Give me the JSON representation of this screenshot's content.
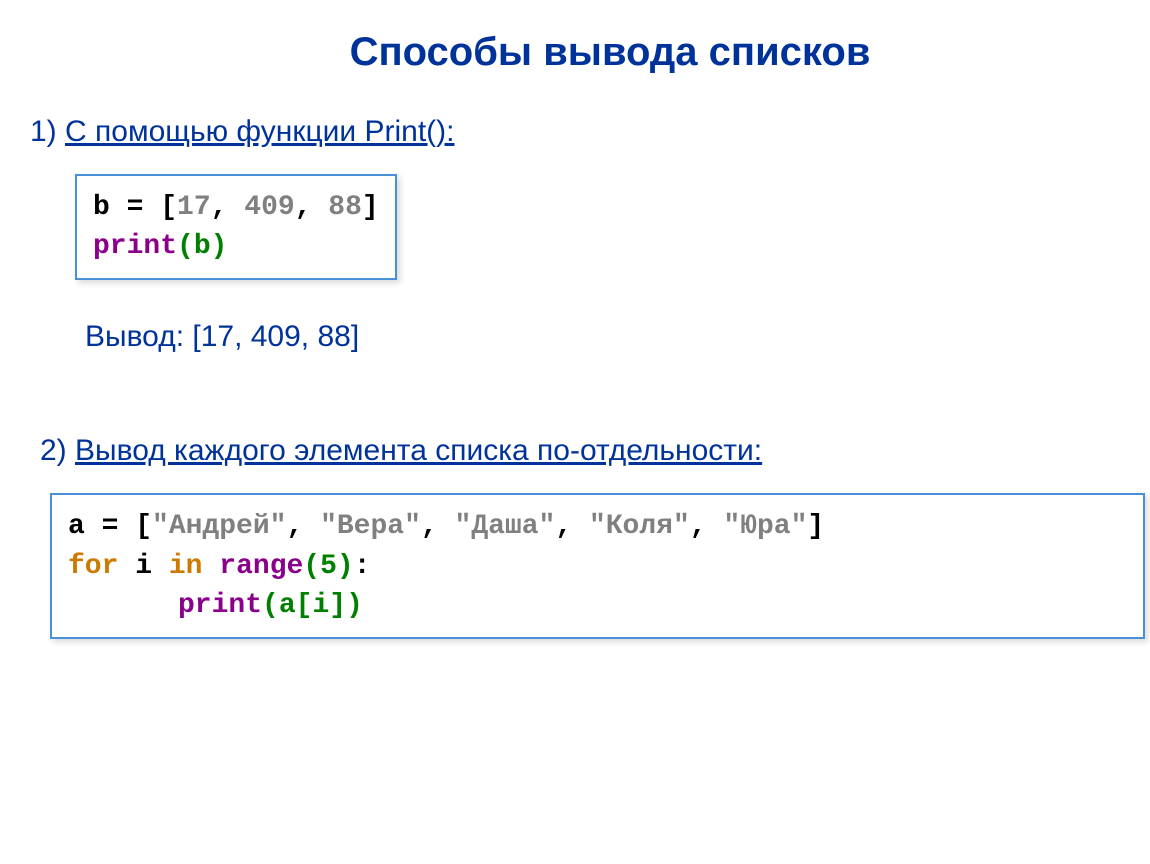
{
  "title": "Способы вывода списков",
  "section1": {
    "num": "1) ",
    "label": "С помощью функции Print():"
  },
  "code1": {
    "l1_var": "b",
    "l1_eq": " = ",
    "l1_open": "[",
    "l1_v1": "17",
    "l1_c1": ", ",
    "l1_v2": "409",
    "l1_c2": ", ",
    "l1_v3": "88",
    "l1_close": "]",
    "l2_func": "print",
    "l2_open": "(",
    "l2_arg": "b",
    "l2_close": ")"
  },
  "output": "Вывод: [17, 409, 88]",
  "section2": {
    "num": "2) ",
    "label": "Вывод каждого элемента списка по-отдельности:"
  },
  "code2": {
    "l1_var": "a",
    "l1_eq": " = ",
    "l1_open": "[",
    "l1_s1": "\"Андрей\"",
    "l1_c1": ", ",
    "l1_s2": "\"Вера\"",
    "l1_c2": ", ",
    "l1_s3": "\"Даша\"",
    "l1_c3": ", ",
    "l1_s4": "\"Коля\"",
    "l1_c4": ", ",
    "l1_s5": "\"Юра\"",
    "l1_close": "]",
    "l2_for": "for",
    "l2_sp1": " ",
    "l2_i": "i",
    "l2_sp2": " ",
    "l2_in": "in",
    "l2_sp3": " ",
    "l2_range": "range",
    "l2_open": "(",
    "l2_five": "5",
    "l2_close": ")",
    "l2_colon": ":",
    "l3_func": "print",
    "l3_open": "(",
    "l3_a": "a",
    "l3_bopen": "[",
    "l3_i": "i",
    "l3_bclose": "]",
    "l3_close": ")"
  }
}
